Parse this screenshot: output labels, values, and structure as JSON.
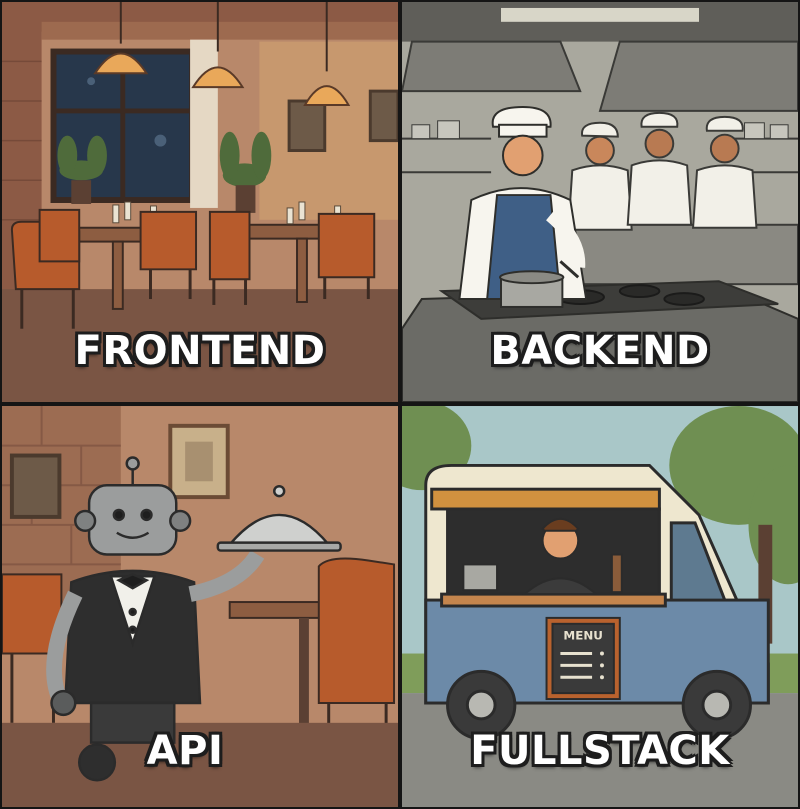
{
  "panels": {
    "frontend": {
      "label": "FRONTEND"
    },
    "backend": {
      "label": "BACKEND"
    },
    "api": {
      "label": "API"
    },
    "fullstack": {
      "label": "FULLSTACK",
      "menu_sign": "MENU"
    }
  },
  "colors": {
    "restaurant_wall": "#b8886a",
    "restaurant_floor": "#7a5544",
    "chair_orange": "#b75b2c",
    "kitchen_gray": "#8f8e87",
    "chef_apron_blue": "#3f5f86",
    "robot_gray": "#9b9d9d",
    "truck_blue": "#6c8aa8",
    "truck_cream": "#eee7cf",
    "sky": "#a9c7c8",
    "tree_green": "#6f8f52",
    "label_text": "#ffffff",
    "label_outline": "#1d1d1d"
  }
}
